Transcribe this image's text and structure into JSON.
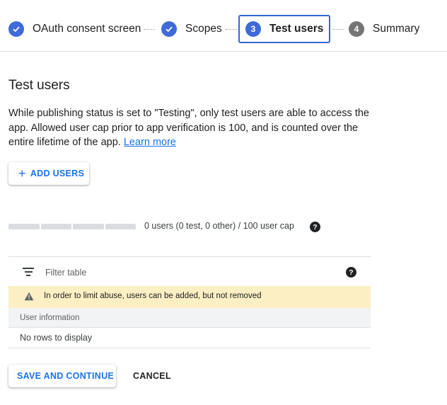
{
  "stepper": {
    "steps": [
      {
        "label": "OAuth consent screen",
        "state": "done",
        "icon": "check-icon"
      },
      {
        "label": "Scopes",
        "state": "done",
        "icon": "check-icon"
      },
      {
        "label": "Test users",
        "state": "current",
        "number": "3"
      },
      {
        "label": "Summary",
        "state": "todo",
        "number": "4"
      }
    ]
  },
  "page": {
    "title": "Test users",
    "description": "While publishing status is set to \"Testing\", only test users are able to access the app. Allowed user cap prior to app verification is 100, and is counted over the entire lifetime of the app.",
    "learn_more": "Learn more"
  },
  "add_users": {
    "icon": "plus-icon",
    "label": "ADD USERS"
  },
  "user_cap": {
    "text": "0 users (0 test, 0 other) / 100 user cap",
    "used": 0,
    "cap": 100,
    "help_icon": "help-icon"
  },
  "table": {
    "filter_placeholder": "Filter table",
    "filter_icon": "filter-icon",
    "help_icon": "help-icon",
    "warning": {
      "icon": "warning-icon",
      "text": "In order to limit abuse, users can be added, but not removed"
    },
    "columns": [
      "User information"
    ],
    "empty_text": "No rows to display"
  },
  "actions": {
    "save": "SAVE AND CONTINUE",
    "cancel": "CANCEL"
  },
  "colors": {
    "accent": "#1a73e8",
    "step_active": "#3f6ad8",
    "warning_bg": "#fcefc4"
  }
}
